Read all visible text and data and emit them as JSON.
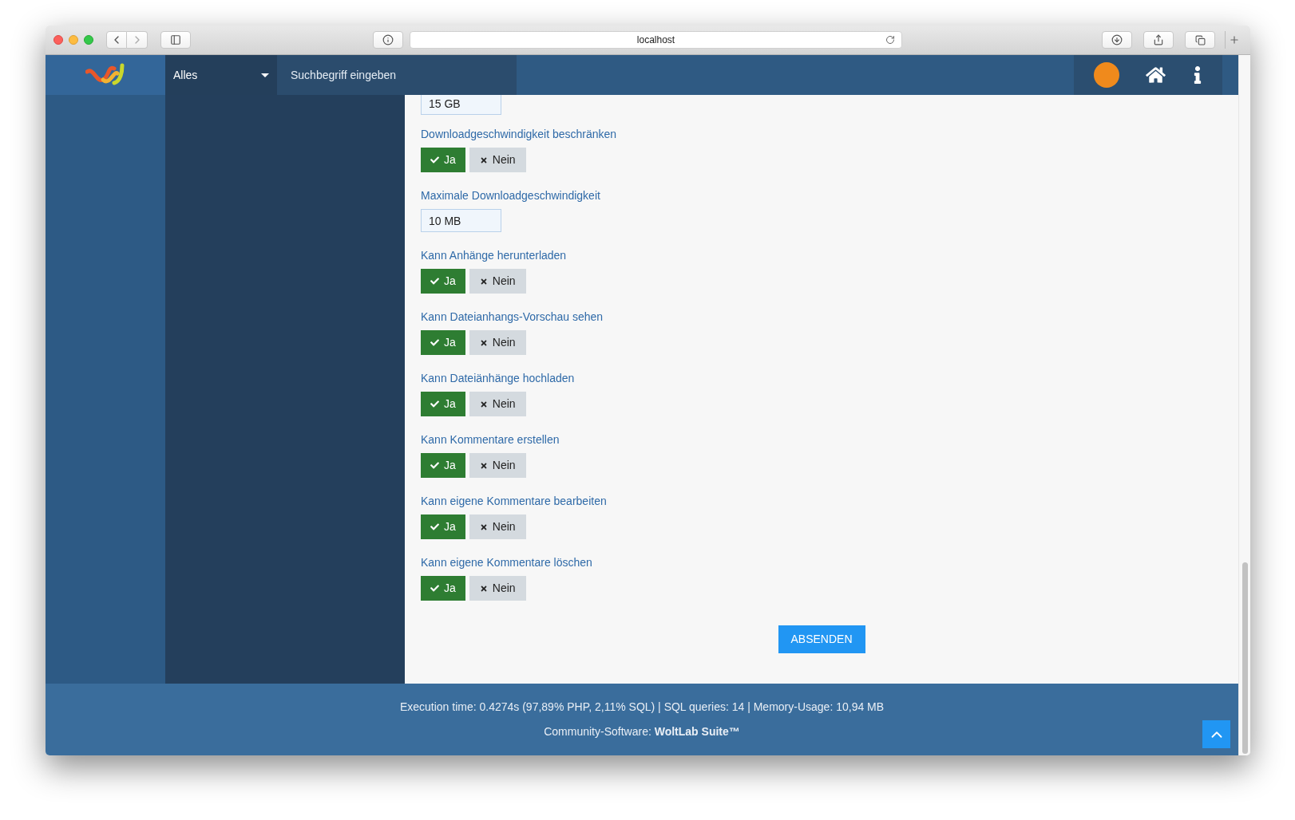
{
  "browser": {
    "address": "localhost"
  },
  "header": {
    "search_scope": "Alles",
    "search": {
      "placeholder": "Suchbegriff eingeben"
    }
  },
  "form": {
    "fields": [
      {
        "kind": "input",
        "value": "15 GB"
      },
      {
        "kind": "toggle",
        "label": "Downloadgeschwindigkeit beschränken",
        "options": [
          {
            "label": "Ja",
            "selected": true
          },
          {
            "label": "Nein",
            "selected": false
          }
        ]
      },
      {
        "kind": "input",
        "label": "Maximale Downloadgeschwindigkeit",
        "value": "10 MB"
      },
      {
        "kind": "toggle",
        "label": "Kann Anhänge herunterladen",
        "options": [
          {
            "label": "Ja",
            "selected": true
          },
          {
            "label": "Nein",
            "selected": false
          }
        ]
      },
      {
        "kind": "toggle",
        "label": "Kann Dateianhangs-Vorschau sehen",
        "options": [
          {
            "label": "Ja",
            "selected": true
          },
          {
            "label": "Nein",
            "selected": false
          }
        ]
      },
      {
        "kind": "toggle",
        "label": "Kann Dateiänhänge hochladen",
        "options": [
          {
            "label": "Ja",
            "selected": true
          },
          {
            "label": "Nein",
            "selected": false
          }
        ]
      },
      {
        "kind": "toggle",
        "label": "Kann Kommentare erstellen",
        "options": [
          {
            "label": "Ja",
            "selected": true
          },
          {
            "label": "Nein",
            "selected": false
          }
        ]
      },
      {
        "kind": "toggle",
        "label": "Kann eigene Kommentare bearbeiten",
        "options": [
          {
            "label": "Ja",
            "selected": true
          },
          {
            "label": "Nein",
            "selected": false
          }
        ]
      },
      {
        "kind": "toggle",
        "label": "Kann eigene Kommentare löschen",
        "options": [
          {
            "label": "Ja",
            "selected": true
          },
          {
            "label": "Nein",
            "selected": false
          }
        ]
      }
    ],
    "submit": "ABSENDEN"
  },
  "footer": {
    "stats": "Execution time: 0.4274s (97,89% PHP, 2,11% SQL) | SQL queries: 14 | Memory-Usage: 10,94 MB",
    "credit": "Community-Software: **WoltLab Suite™**"
  }
}
